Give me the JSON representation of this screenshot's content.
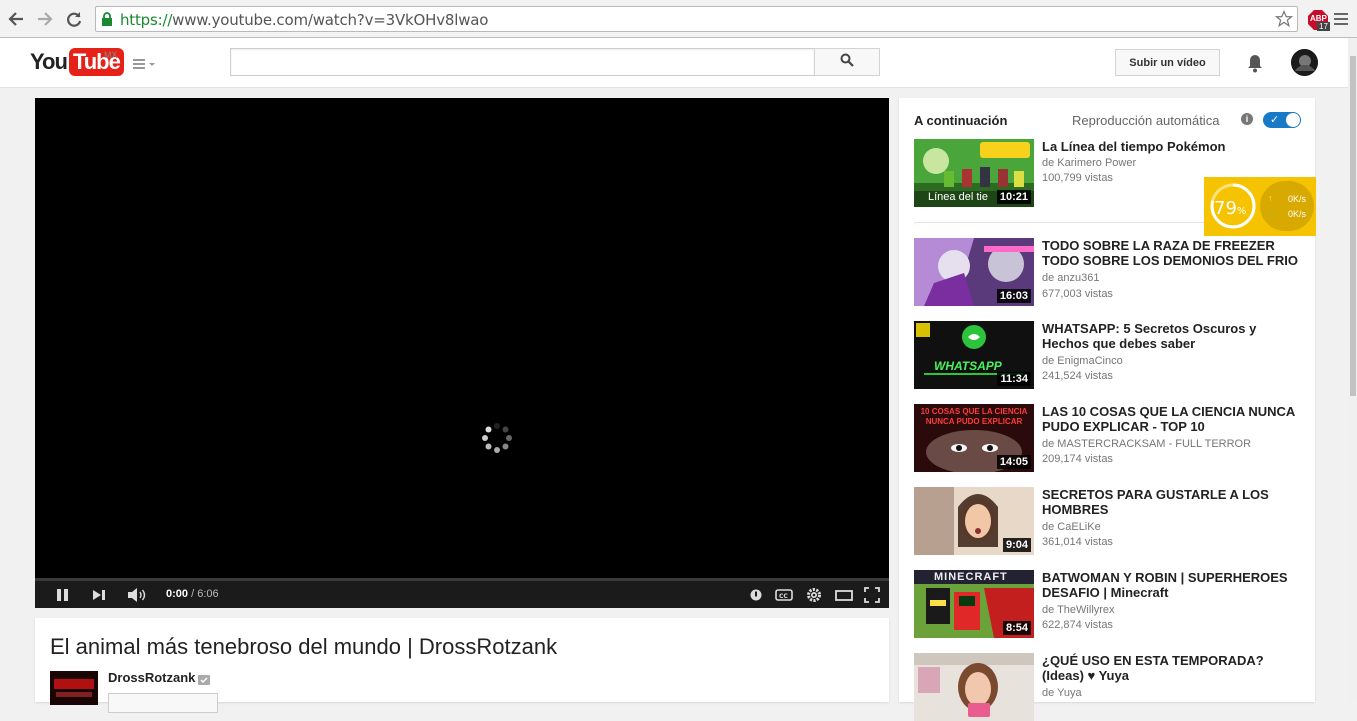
{
  "browser": {
    "url_scheme": "https://",
    "url_rest": "www.youtube.com/watch?v=3VkOHv8lwao",
    "abp_label": "ABP",
    "abp_count": "17"
  },
  "header": {
    "logo_you": "You",
    "logo_tube": "Tube",
    "region": "MX",
    "search_placeholder": "",
    "upload_label": "Subir un vídeo"
  },
  "player": {
    "current_time": "0:00",
    "duration": "/ 6:06"
  },
  "video": {
    "title": "El animal más tenebroso del mundo | DrossRotzank",
    "channel": "DrossRotzank"
  },
  "sidebar": {
    "up_next": "A continuación",
    "autoplay_label": "Reproducción automática",
    "items": [
      {
        "title": "La Línea del tiempo Pokémon",
        "channel": "de Karimero Power",
        "views": "100,799 vistas",
        "duration": "10:21",
        "thumb_text": "Línea del tie"
      },
      {
        "title": "TODO SOBRE LA RAZA DE FREEZER TODO SOBRE LOS DEMONIOS DEL FRIO",
        "channel": "de anzu361",
        "views": "677,003 vistas",
        "duration": "16:03"
      },
      {
        "title": "WHATSAPP: 5 Secretos Oscuros y Hechos que debes saber",
        "channel": "de EnigmaCinco",
        "views": "241,524 vistas",
        "duration": "11:34",
        "thumb_text": "WHATSAPP"
      },
      {
        "title": "LAS 10 COSAS QUE LA CIENCIA NUNCA PUDO EXPLICAR - TOP 10",
        "channel": "de MASTERCRACKSAM - FULL TERROR",
        "views": "209,174 vistas",
        "duration": "14:05",
        "thumb_text": "10 COSAS QUE LA CIENCIA NUNCA PUDO EXPLICAR"
      },
      {
        "title": "SECRETOS PARA GUSTARLE A LOS HOMBRES",
        "channel": "de CaELiKe",
        "views": "361,014 vistas",
        "duration": "9:04"
      },
      {
        "title": "BATWOMAN Y ROBIN | SUPERHEROES DESAFIO | Minecraft",
        "channel": "de TheWillyrex",
        "views": "622,874 vistas",
        "duration": "8:54",
        "thumb_text": "MINECRAFT"
      },
      {
        "title": "¿QUÉ USO EN ESTA TEMPORADA? (Ideas) ♥ Yuya",
        "channel": "de Yuya",
        "views": "",
        "duration": ""
      }
    ]
  },
  "speed_widget": {
    "percent": "79",
    "percent_sign": "%",
    "upload": "0K/s",
    "download": "0K/s"
  },
  "colors": {
    "brand_red": "#e62117",
    "toggle_blue": "#167ac6",
    "widget_yellow": "#f6c300"
  }
}
